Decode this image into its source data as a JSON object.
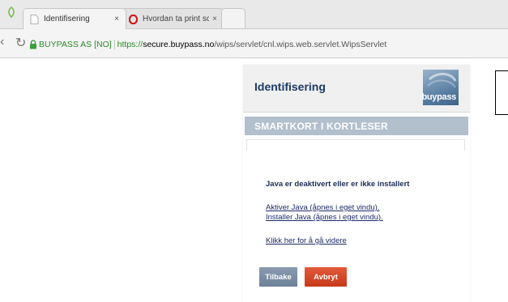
{
  "browser": {
    "tabs": [
      {
        "title": "Identifisering",
        "close": "×",
        "active": true
      },
      {
        "title": "Hvordan ta print screen p",
        "title_fade": "å",
        "close": "×",
        "active": false
      }
    ],
    "address_bar": {
      "ev_label": "BUYPASS AS [NO]",
      "scheme": "https://",
      "host": "secure.buypass.no",
      "path": "/wips/servlet/cnl.wips.web.servlet.WipsServlet"
    },
    "nav_icons": [
      "back-arrow-icon",
      "reload-icon",
      "lock-icon"
    ]
  },
  "page": {
    "title": "Identifisering",
    "logo": "buypass",
    "section_title": "SMARTKORT I KORTLESER",
    "java_message": "Java er deaktivert eller er ikke installert",
    "links": {
      "aktiver": "Aktiver Java (åpnes i eget vindu).",
      "installer": "Installer Java (åpnes i eget vindu).",
      "continue": "Klikk her for å gå videre"
    },
    "buttons": {
      "back": "Tilbake",
      "cancel": "Avbryt"
    }
  },
  "colors": {
    "title_blue": "#1c3a66",
    "section_bar": "#b2bfcc",
    "back_button": "#7a8ca3",
    "cancel_button": "#d4472a",
    "secure_green": "#2a8b2a"
  }
}
